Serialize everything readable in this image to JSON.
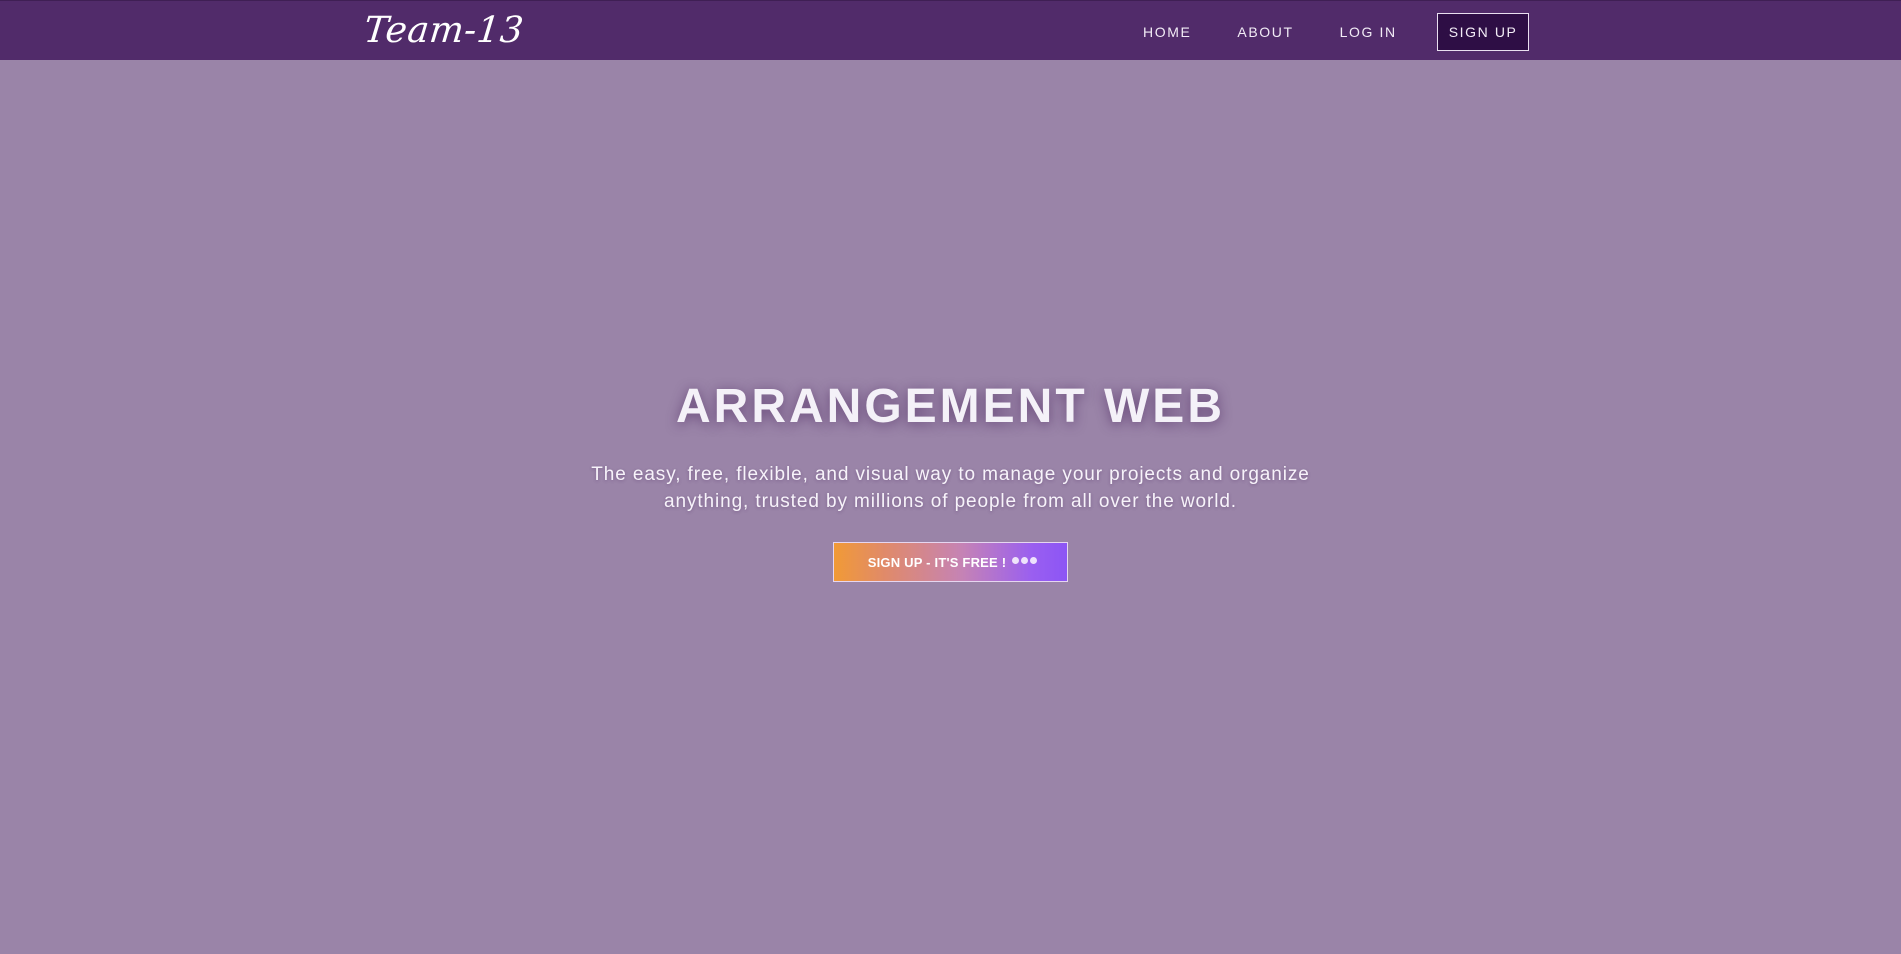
{
  "navbar": {
    "brand": "Team-13",
    "links": [
      {
        "label": "HOME"
      },
      {
        "label": "ABOUT"
      },
      {
        "label": "LOG IN"
      },
      {
        "label": "SIGN UP"
      }
    ]
  },
  "hero": {
    "title": "ARRANGEMENT WEB",
    "subtitle_line1": "The easy, free, flexible, and visual way to manage your projects and organize",
    "subtitle_line2": "anything, trusted by millions of people from all over the world.",
    "cta_label": "SIGN UP - IT'S FREE !",
    "cta_indicator_icon": "loading-dots-icon"
  },
  "colors": {
    "navbar_bg": "#512b6a",
    "page_bg": "#9a84a8",
    "cta_gradient_start": "#f19a36",
    "cta_gradient_end": "#8c55f5",
    "signup_bg": "#2e0e45"
  }
}
